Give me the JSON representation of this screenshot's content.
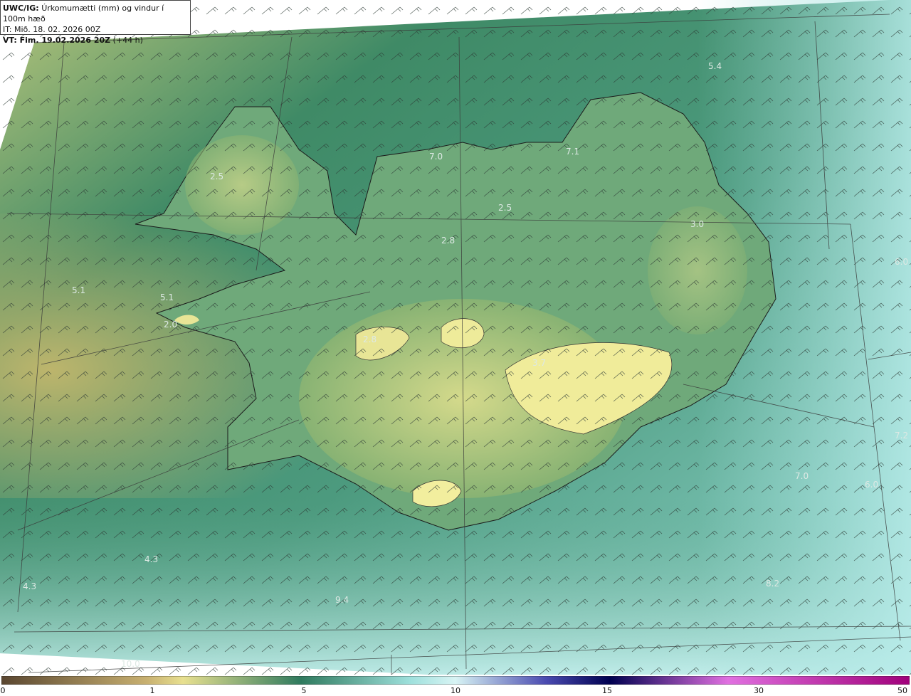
{
  "header": {
    "product": "UWC/IG:",
    "description": "Úrkomumætti (mm) og vindur í 100m hæð",
    "it_line": "IT: Mið. 18. 02. 2026 00Z",
    "vt_bold": "VT: Fim. 19.02.2026 20Z",
    "vt_offset": "(+44 h)"
  },
  "map_labels": [
    {
      "text": "5.4"
    },
    {
      "text": "7.0"
    },
    {
      "text": "7.1"
    },
    {
      "text": "2.5"
    },
    {
      "text": "2.8"
    },
    {
      "text": "2.5"
    },
    {
      "text": "3.0"
    },
    {
      "text": "6.0"
    },
    {
      "text": "5.1"
    },
    {
      "text": "5.1"
    },
    {
      "text": "2.0"
    },
    {
      "text": "2.8"
    },
    {
      "text": "3.7"
    },
    {
      "text": "7.2"
    },
    {
      "text": "7.0"
    },
    {
      "text": "6.0"
    },
    {
      "text": "4.3"
    },
    {
      "text": "4.3"
    },
    {
      "text": "8.2"
    },
    {
      "text": "9.4"
    },
    {
      "text": "10.0"
    }
  ],
  "colorbar": {
    "ticks": [
      "0",
      "1",
      "5",
      "10",
      "15",
      "30",
      "50"
    ],
    "colors": [
      "#5a4630",
      "#c8b070",
      "#e8e090",
      "#2f7a5e",
      "#9ee0dc",
      "#d8f4f4",
      "#1a1a7a",
      "#000050",
      "#e070e0",
      "#a0007a"
    ]
  }
}
